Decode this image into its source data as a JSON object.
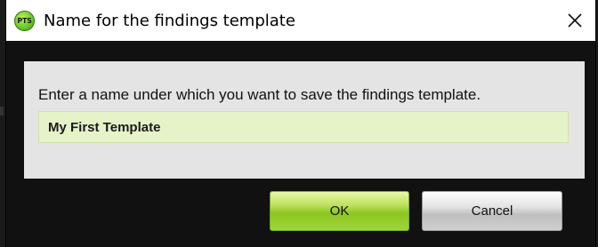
{
  "window": {
    "title": "Name for the findings template",
    "app_icon_label": "PTS",
    "close_symbol": "✕"
  },
  "form": {
    "prompt": "Enter a name under which you want to save the findings template.",
    "name_value": "My First Template"
  },
  "buttons": {
    "ok_label": "OK",
    "cancel_label": "Cancel"
  },
  "colors": {
    "input_background": "#e6f2c8",
    "ok_green": "#8cc620",
    "dialog_background": "#111111",
    "panel_background": "#e4e4e4"
  }
}
